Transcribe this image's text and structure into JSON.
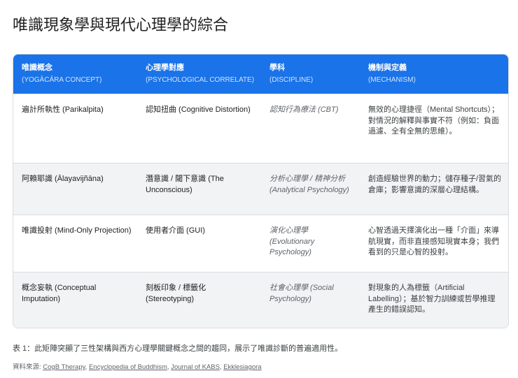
{
  "title": "唯識現象學與現代心理學的綜合",
  "headers": [
    {
      "main": "唯識概念",
      "sub": "(YOGĀCĀRA CONCEPT)"
    },
    {
      "main": "心理學對應",
      "sub": "(PSYCHOLOGICAL CORRELATE)"
    },
    {
      "main": "學科",
      "sub": "(DISCIPLINE)"
    },
    {
      "main": "機制與定義",
      "sub": "(MECHANISM)"
    }
  ],
  "rows": [
    [
      "遍計所執性 (Parikalpita)",
      "認知扭曲 (Cognitive Distortion)",
      "認知行為療法 (CBT)",
      "無效的心理捷徑（Mental Shortcuts）；對情況的解釋與事實不符（例如：負面過濾、全有全無的思維）。"
    ],
    [
      "阿賴耶識 (Ālayavijñāna)",
      "潛意識 / 閾下意識 (The Unconscious)",
      "分析心理學 / 精神分析 (Analytical Psychology)",
      "創造經驗世界的動力；儲存種子/習氣的倉庫；影響意識的深層心理結構。"
    ],
    [
      "唯識投射 (Mind-Only Projection)",
      "使用者介面 (GUI)",
      "演化心理學 (Evolutionary Psychology)",
      "心智透過天擇演化出一種「介面」來導航現實，而非直接感知現實本身；我們看到的只是心智的投射。"
    ],
    [
      "概念妄執 (Conceptual Imputation)",
      "刻板印象 / 標籤化 (Stereotyping)",
      "社會心理學 (Social Psychology)",
      "對現象的人為標籤（Artificial Labelling）；基於智力訓練或哲學推理產生的錯誤認知。"
    ]
  ],
  "caption": "表 1：此矩陣突顯了三性架構與西方心理學關鍵概念之間的趨同，展示了唯識診斷的普遍適用性。",
  "sources_label": "資料來源:",
  "sources": [
    "CogB Therapy",
    "Encyclopedia of Buddhism",
    "Journal of KABS",
    "Ekklesiagora"
  ]
}
